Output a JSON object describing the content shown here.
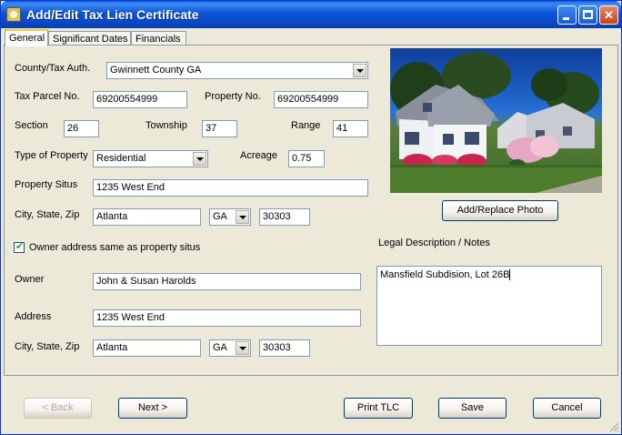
{
  "window": {
    "title": "Add/Edit Tax Lien Certificate"
  },
  "tabs": [
    {
      "label": "General"
    },
    {
      "label": "Significant Dates"
    },
    {
      "label": "Financials"
    }
  ],
  "form": {
    "county_label": "County/Tax Auth.",
    "county_value": "Gwinnett County GA",
    "tax_parcel_label": "Tax Parcel No.",
    "tax_parcel_value": "69200554999",
    "property_no_label": "Property No.",
    "property_no_value": "69200554999",
    "section_label": "Section",
    "section_value": "26",
    "township_label": "Township",
    "township_value": "37",
    "range_label": "Range",
    "range_value": "41",
    "type_label": "Type of Property",
    "type_value": "Residential",
    "acreage_label": "Acreage",
    "acreage_value": "0.75",
    "situs_label": "Property Situs",
    "situs_value": "1235 West End",
    "csz_label": "City, State, Zip",
    "city_value": "Atlanta",
    "state_value": "GA",
    "zip_value": "30303",
    "same_address_label": "Owner address same as property situs",
    "same_address_checked": true,
    "owner_label": "Owner",
    "owner_value": "John & Susan Harolds",
    "address_label": "Address",
    "address_value": "1235 West End",
    "owner_csz_label": "City, State, Zip",
    "owner_city_value": "Atlanta",
    "owner_state_value": "GA",
    "owner_zip_value": "30303"
  },
  "photo": {
    "button_label": "Add/Replace Photo"
  },
  "legal": {
    "label": "Legal Description / Notes",
    "value": "Mansfield Subdision, Lot 26B"
  },
  "buttons": {
    "back": "< Back",
    "next": "Next >",
    "print": "Print TLC",
    "save": "Save",
    "cancel": "Cancel"
  }
}
